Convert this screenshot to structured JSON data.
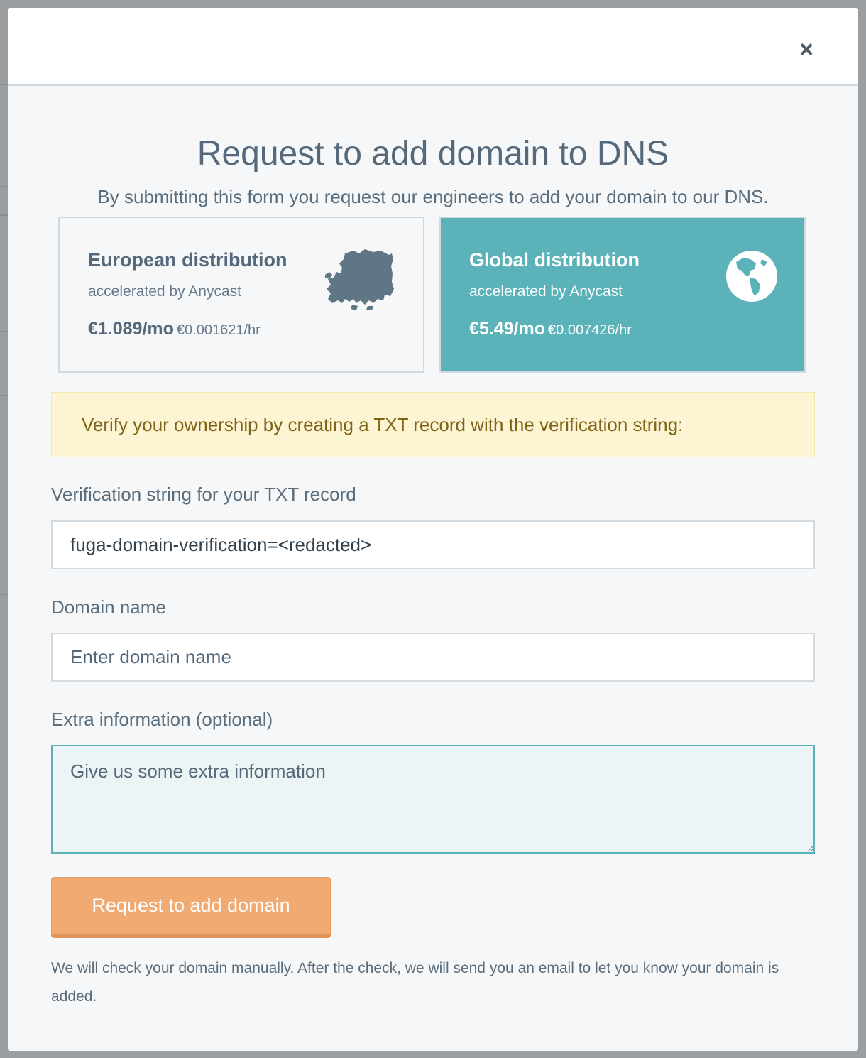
{
  "modal": {
    "close_glyph": "×",
    "title": "Request to add domain to DNS",
    "subtitle": "By submitting this form you request our engineers to add your domain to our DNS."
  },
  "plans": [
    {
      "name": "European distribution",
      "subtitle": "accelerated by Anycast",
      "price": "€1.089/mo",
      "hourly": "€0.001621/hr",
      "icon": "europe-map-icon",
      "selected": false
    },
    {
      "name": "Global distribution",
      "subtitle": "accelerated by Anycast",
      "price": "€5.49/mo",
      "hourly": "€0.007426/hr",
      "icon": "globe-americas-icon",
      "selected": true
    }
  ],
  "alert": {
    "text": "Verify your ownership by creating a TXT record with the verification string:"
  },
  "form": {
    "verification_label": "Verification string for your TXT record",
    "verification_value": "fuga-domain-verification=<redacted>",
    "domain_label": "Domain name",
    "domain_placeholder": "Enter domain name",
    "extra_label": "Extra information (optional)",
    "extra_placeholder": "Give us some extra information",
    "submit_label": "Request to add domain",
    "note": "We will check your domain manually. After the check, we will send you an email to let you know your domain is added."
  },
  "colors": {
    "accent_teal": "#5bb2b9",
    "button_orange": "#f0aa72",
    "alert_bg": "#fcf4d3",
    "alert_text": "#7e6416",
    "heading": "#55697a"
  }
}
